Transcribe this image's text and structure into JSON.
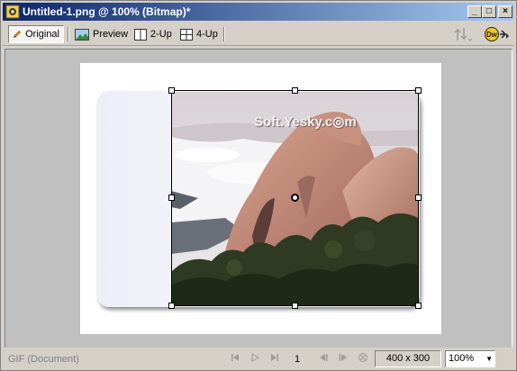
{
  "window": {
    "title": "Untitled-1.png @ 100% (Bitmap)*",
    "controls": {
      "minimize": "_",
      "maximize": "□",
      "close": "×"
    }
  },
  "toolbar": {
    "tabs": [
      {
        "label": "Original",
        "icon": "pencil-icon",
        "active": true
      },
      {
        "label": "Preview",
        "icon": "preview-image-icon",
        "active": false
      },
      {
        "label": "2-Up",
        "icon": "two-up-icon",
        "active": false
      },
      {
        "label": "4-Up",
        "icon": "four-up-icon",
        "active": false
      }
    ],
    "right_icons": [
      "export-arrows-icon",
      "jump-to-app-icon"
    ]
  },
  "canvas": {
    "watermark": "Soft.Yesky.c◎m",
    "document_color": "#ffffff",
    "canvas_color": "#c0c0c0"
  },
  "statusbar": {
    "format": "GIF (Document)",
    "frame": "1",
    "dimensions": "400 x 300",
    "zoom": "100%",
    "nav_icons": [
      "first-frame-icon",
      "play-icon",
      "last-frame-icon",
      "prev-frame-icon",
      "next-frame-icon",
      "stop-icon"
    ]
  }
}
